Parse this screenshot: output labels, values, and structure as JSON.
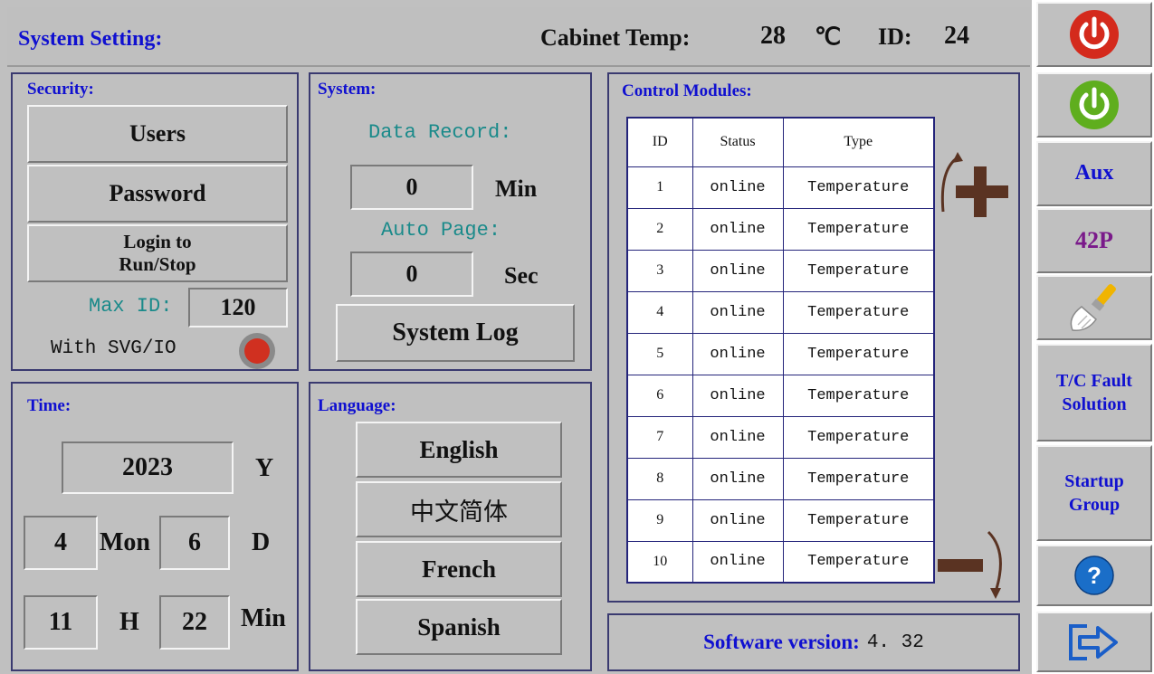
{
  "header": {
    "title": "System Setting:",
    "cabinet_temp_label": "Cabinet Temp:",
    "cabinet_temp_value": "28",
    "temp_unit": "℃",
    "id_label": "ID:",
    "id_value": "24"
  },
  "security": {
    "title": "Security:",
    "users_label": "Users",
    "password_label": "Password",
    "login_line1": "Login to",
    "login_line2": "Run/Stop",
    "max_id_label": "Max ID:",
    "max_id_value": "120",
    "svg_io_label": "With SVG/IO",
    "svg_io_status_color": "#d03020"
  },
  "system": {
    "title": "System:",
    "data_record_label": "Data Record:",
    "data_record_value": "0",
    "data_record_unit": "Min",
    "auto_page_label": "Auto Page:",
    "auto_page_value": "0",
    "auto_page_unit": "Sec",
    "system_log_label": "System Log"
  },
  "time": {
    "title": "Time:",
    "year": "2023",
    "year_unit": "Y",
    "month": "4",
    "month_unit": "Mon",
    "day": "6",
    "day_unit": "D",
    "hour": "11",
    "hour_unit": "H",
    "minute": "22",
    "minute_unit": "Min"
  },
  "language": {
    "title": "Language:",
    "options": [
      "English",
      "中文简体",
      "French",
      "Spanish"
    ]
  },
  "modules": {
    "title": "Control Modules:",
    "columns": [
      "ID",
      "Status",
      "Type"
    ],
    "rows": [
      [
        "1",
        "online",
        "Temperature"
      ],
      [
        "2",
        "online",
        "Temperature"
      ],
      [
        "3",
        "online",
        "Temperature"
      ],
      [
        "4",
        "online",
        "Temperature"
      ],
      [
        "5",
        "online",
        "Temperature"
      ],
      [
        "6",
        "online",
        "Temperature"
      ],
      [
        "7",
        "online",
        "Temperature"
      ],
      [
        "8",
        "online",
        "Temperature"
      ],
      [
        "9",
        "online",
        "Temperature"
      ],
      [
        "10",
        "online",
        "Temperature"
      ]
    ]
  },
  "version": {
    "label": "Software version:",
    "value": "4. 32"
  },
  "sidebar": {
    "power_off_icon": "power-red-icon",
    "power_on_icon": "power-green-icon",
    "aux_label": "Aux",
    "p42_label": "42P",
    "clean_icon": "brush-icon",
    "tc_fault_line1": "T/C Fault",
    "tc_fault_line2": "Solution",
    "startup_line1": "Startup",
    "startup_line2": "Group",
    "help_icon": "help-icon",
    "exit_icon": "exit-icon"
  },
  "colors": {
    "accent_blue": "#1010d0",
    "teal": "#1a8a8a",
    "power_red": "#d42a1c",
    "power_green": "#5fae1e",
    "label_purple": "#7a1a8a",
    "arrow_brown": "#5a3322"
  }
}
